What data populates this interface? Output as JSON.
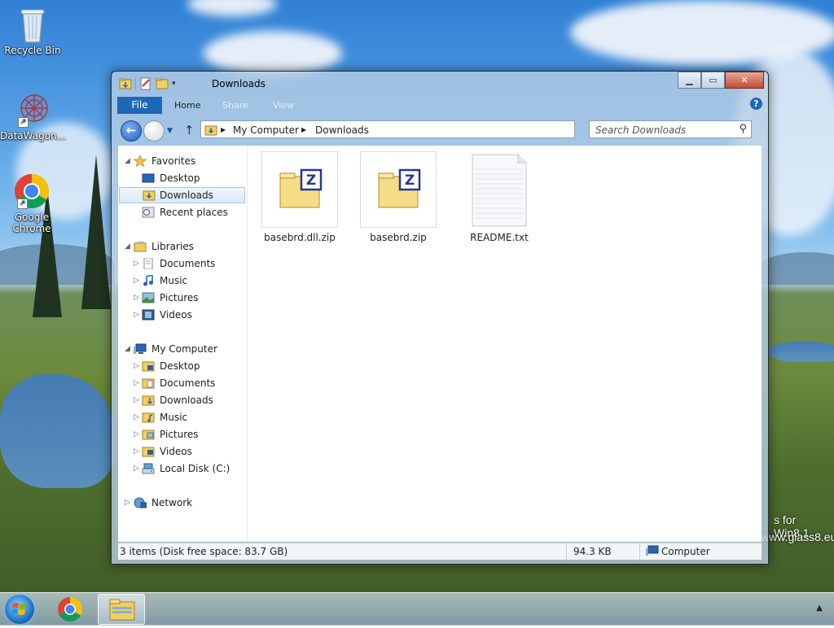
{
  "desktop": {
    "icons": [
      {
        "label": "Recycle Bin"
      },
      {
        "label": "DataWagon..."
      },
      {
        "label": "Google Chrome"
      }
    ],
    "watermark_line1": "s for Win8.1",
    "watermark_line2": "www.glass8.eu"
  },
  "window": {
    "title": "Downloads",
    "ribbon_tabs": [
      "File",
      "Home",
      "Share",
      "View"
    ],
    "address_path": [
      "My Computer",
      "Downloads"
    ],
    "search_placeholder": "Search Downloads",
    "navigation": {
      "favorites": {
        "label": "Favorites",
        "items": [
          "Desktop",
          "Downloads",
          "Recent places"
        ],
        "selected": "Downloads"
      },
      "libraries": {
        "label": "Libraries",
        "items": [
          "Documents",
          "Music",
          "Pictures",
          "Videos"
        ]
      },
      "computer": {
        "label": "My Computer",
        "items": [
          "Desktop",
          "Documents",
          "Downloads",
          "Music",
          "Pictures",
          "Videos",
          "Local Disk (C:)"
        ]
      },
      "network": {
        "label": "Network"
      }
    },
    "files": [
      {
        "name": "basebrd.dll.zip",
        "icon": "zip-folder-icon"
      },
      {
        "name": "basebrd.zip",
        "icon": "zip-folder-icon"
      },
      {
        "name": "README.txt",
        "icon": "text-file-icon"
      }
    ],
    "status": {
      "items_text": "3 items (Disk free space: 83.7 GB)",
      "size": "94.3 KB",
      "location": "Computer"
    }
  },
  "colors": {
    "file_tab": "#1f67b7",
    "selection": "#dbe9f9",
    "close_button": "#c24a32"
  }
}
